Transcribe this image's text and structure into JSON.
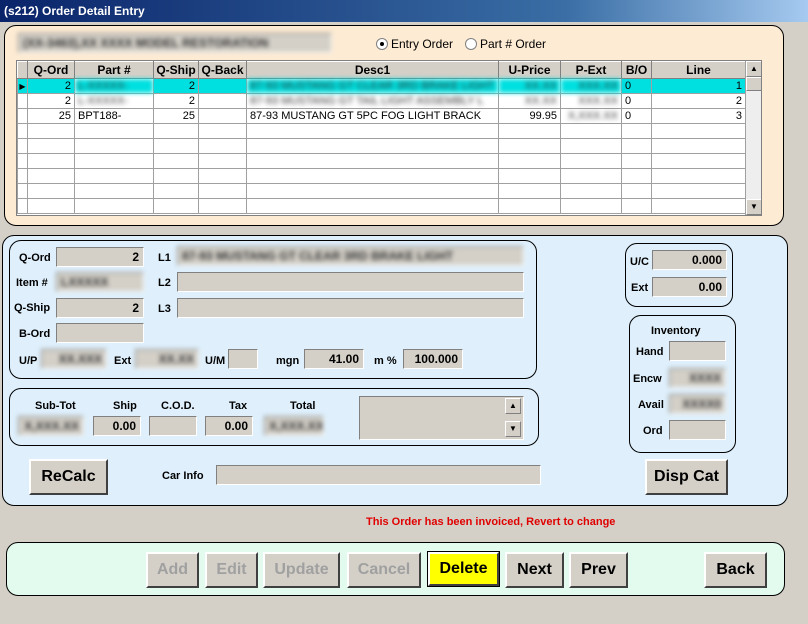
{
  "window": {
    "title": "(s212)  Order Detail Entry"
  },
  "header": {
    "customer_field": "(XX-3463),XX   XXXX MODEL RESTORATION",
    "radio_entry": "Entry Order",
    "radio_part": "Part # Order"
  },
  "grid": {
    "columns": [
      "Q-Ord",
      "Part #",
      "Q-Ship",
      "Q-Back",
      "Desc1",
      "U-Price",
      "P-Ext",
      "B/O",
      "Line"
    ],
    "rows": [
      {
        "q_ord": "2",
        "part": "L-XXXXX-",
        "q_ship": "2",
        "q_back": "",
        "desc": "87-93 MUSTANG GT CLEAR 3RD BRAKE LIGHT 3",
        "u_price": "XX.XX",
        "p_ext": "XXX.XX",
        "bo": "0",
        "line": "1"
      },
      {
        "q_ord": "2",
        "part": "L-XXXXX-",
        "q_ship": "2",
        "q_back": "",
        "desc": "87-93 MUSTANG GT TAIL LIGHT ASSEMBLY L",
        "u_price": "XX.XX",
        "p_ext": "XXX.XX",
        "bo": "0",
        "line": "2"
      },
      {
        "q_ord": "25",
        "part": "BPT188-",
        "q_ship": "25",
        "q_back": "",
        "desc": "87-93 MUSTANG GT 5PC FOG LIGHT BRACK",
        "u_price": "99.95",
        "p_ext": "X,XXX.XX",
        "bo": "0",
        "line": "3"
      }
    ]
  },
  "detail": {
    "q_ord_label": "Q-Ord",
    "q_ord": "2",
    "item_label": "Item #",
    "item": "LXXXXX",
    "q_ship_label": "Q-Ship",
    "q_ship": "2",
    "b_ord_label": "B-Ord",
    "b_ord": "",
    "l1_label": "L1",
    "l1": "87-93 MUSTANG GT CLEAR 3RD BRAKE LIGHT",
    "l2_label": "L2",
    "l2": "",
    "l3_label": "L3",
    "l3": "",
    "up_label": "U/P",
    "up": "XX.XXX",
    "ext_label": "Ext",
    "ext": "XX.XX",
    "um_label": "U/M",
    "um": "",
    "mgn_label": "mgn",
    "mgn": "41.00",
    "mpct_label": "m %",
    "mpct": "100.000"
  },
  "uc": {
    "uc_label": "U/C",
    "uc": "0.000",
    "ext_label": "Ext",
    "ext": "0.00"
  },
  "totals": {
    "subtot_label": "Sub-Tot",
    "subtot": "X,XXX.XX",
    "ship_label": "Ship",
    "ship": "0.00",
    "cod_label": "C.O.D.",
    "cod": "",
    "tax_label": "Tax",
    "tax": "0.00",
    "total_label": "Total",
    "total": "X,XXX.XX"
  },
  "inventory": {
    "title": "Inventory",
    "hand_label": "Hand",
    "hand": "",
    "encw_label": "Encw",
    "encw": "XXXX",
    "avail_label": "Avail",
    "avail": "XXXX0",
    "ord_label": "Ord",
    "ord": ""
  },
  "actions": {
    "recalc": "ReCalc",
    "car_info_label": "Car Info",
    "car_info": "",
    "disp_cat": "Disp Cat",
    "message": "This Order has been invoiced, Revert to change"
  },
  "toolbar": {
    "add": "Add",
    "edit": "Edit",
    "update": "Update",
    "cancel": "Cancel",
    "delete": "Delete",
    "next": "Next",
    "prev": "Prev",
    "back": "Back"
  }
}
